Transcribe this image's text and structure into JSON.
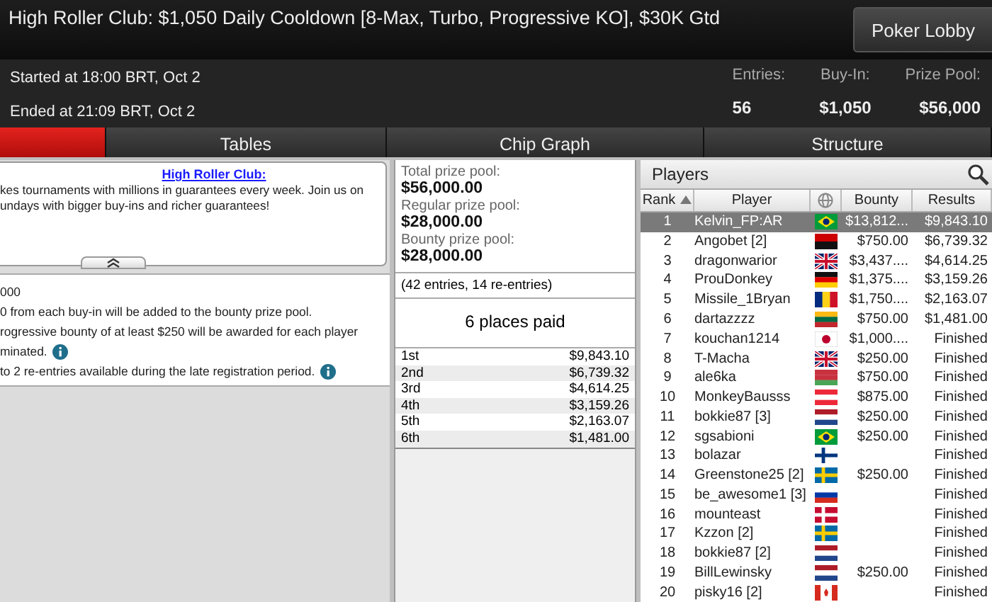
{
  "window": {
    "title": "High Roller Club: $1,050 Daily Cooldown [8-Max, Turbo, Progressive KO], $30K Gtd"
  },
  "lobby_button": "Poker Lobby",
  "times": [
    "Started at 18:00 BRT, Oct 2",
    "Ended at 21:09 BRT, Oct 2"
  ],
  "stats": [
    {
      "label": "Entries:",
      "value": "56"
    },
    {
      "label": "Buy-In:",
      "value": "$1,050"
    },
    {
      "label": "Prize Pool:",
      "value": "$56,000"
    }
  ],
  "tabs": [
    {
      "selected": true
    },
    {
      "label": "Tables",
      "selected": false
    },
    {
      "label": "Chip Graph",
      "selected": false
    },
    {
      "label": "Structure",
      "selected": false
    }
  ],
  "description": {
    "link": "High Roller Club:",
    "lines": [
      "kes tournaments with millions in guarantees every week. Join us on",
      "undays with bigger buy-ins and richer guarantees!"
    ]
  },
  "details": [
    {
      "text": "000",
      "info": false
    },
    {
      "text": "0 from each buy-in will be added to the bounty prize pool.",
      "info": false
    },
    {
      "text": "rogressive bounty of at least $250 will be awarded for each player",
      "info": false
    },
    {
      "text": "minated.",
      "info": true
    },
    {
      "text": "to 2 re-entries available during the late registration period.",
      "info": true
    }
  ],
  "prize_pools": [
    {
      "label": "Total prize pool:",
      "value": "$56,000.00"
    },
    {
      "label": "Regular prize pool:",
      "value": "$28,000.00"
    },
    {
      "label": "Bounty prize pool:",
      "value": "$28,000.00"
    }
  ],
  "entries_note": "(42 entries, 14 re-entries)",
  "places_paid": "6 places paid",
  "payouts": [
    {
      "place": "1st",
      "amount": "$9,843.10"
    },
    {
      "place": "2nd",
      "amount": "$6,739.32"
    },
    {
      "place": "3rd",
      "amount": "$4,614.25"
    },
    {
      "place": "4th",
      "amount": "$3,159.26"
    },
    {
      "place": "5th",
      "amount": "$2,163.07"
    },
    {
      "place": "6th",
      "amount": "$1,481.00"
    }
  ],
  "players": {
    "title": "Players",
    "columns": [
      "Rank",
      "Player",
      "Bounty",
      "Results"
    ],
    "rows": [
      {
        "rank": "1",
        "name": "Kelvin_FP:AR",
        "kind": "brazil",
        "bounty": "$13,812...",
        "result": "$9,843.10",
        "selected": true
      },
      {
        "rank": "2",
        "name": "Angobet [2]",
        "kind": "angola",
        "bounty": "$750.00",
        "result": "$6,739.32",
        "selected": false
      },
      {
        "rank": "3",
        "name": "dragonwarior",
        "kind": "uk",
        "bounty": "$3,437....",
        "result": "$4,614.25",
        "selected": false
      },
      {
        "rank": "4",
        "name": "ProuDonkey",
        "kind": "germany",
        "bounty": "$1,375....",
        "result": "$3,159.26",
        "selected": false
      },
      {
        "rank": "5",
        "name": "Missile_1Bryan",
        "kind": "romania",
        "bounty": "$1,750....",
        "result": "$2,163.07",
        "selected": false
      },
      {
        "rank": "6",
        "name": "dartazzzz",
        "kind": "lithuania",
        "bounty": "$750.00",
        "result": "$1,481.00",
        "selected": false
      },
      {
        "rank": "7",
        "name": "kouchan1214",
        "kind": "japan",
        "bounty": "$1,000....",
        "result": "Finished",
        "selected": false
      },
      {
        "rank": "8",
        "name": "T-Macha",
        "kind": "uk",
        "bounty": "$250.00",
        "result": "Finished",
        "selected": false
      },
      {
        "rank": "9",
        "name": "ale6ka",
        "kind": "belarus",
        "bounty": "$750.00",
        "result": "Finished",
        "selected": false
      },
      {
        "rank": "10",
        "name": "MonkeyBausss",
        "kind": "austria",
        "bounty": "$875.00",
        "result": "Finished",
        "selected": false
      },
      {
        "rank": "11",
        "name": "bokkie87 [3]",
        "kind": "netherlands",
        "bounty": "$250.00",
        "result": "Finished",
        "selected": false
      },
      {
        "rank": "12",
        "name": "sgsabioni",
        "kind": "brazil",
        "bounty": "$250.00",
        "result": "Finished",
        "selected": false
      },
      {
        "rank": "13",
        "name": "bolazar",
        "kind": "finland",
        "result": "Finished",
        "selected": false
      },
      {
        "rank": "14",
        "name": "Greenstone25 [2]",
        "kind": "sweden",
        "bounty": "$250.00",
        "result": "Finished",
        "selected": false
      },
      {
        "rank": "15",
        "name": "be_awesome1 [3]",
        "kind": "russia",
        "result": "Finished",
        "selected": false
      },
      {
        "rank": "16",
        "name": "mounteast",
        "kind": "denmark",
        "result": "Finished",
        "selected": false
      },
      {
        "rank": "17",
        "name": "Kzzon [2]",
        "kind": "sweden",
        "result": "Finished",
        "selected": false
      },
      {
        "rank": "18",
        "name": "bokkie87 [2]",
        "kind": "netherlands",
        "result": "Finished",
        "selected": false
      },
      {
        "rank": "19",
        "name": "BillLewinsky",
        "kind": "netherlands",
        "bounty": "$250.00",
        "result": "Finished",
        "selected": false
      },
      {
        "rank": "20",
        "name": "pisky16 [2]",
        "kind": "canada",
        "result": "Finished",
        "selected": false
      }
    ]
  }
}
